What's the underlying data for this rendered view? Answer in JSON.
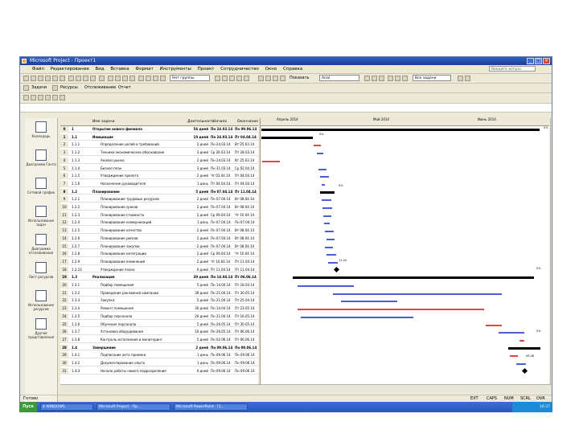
{
  "window": {
    "title": "Microsoft Project - Проект1"
  },
  "menu": {
    "items": [
      "Файл",
      "Редактирование",
      "Вид",
      "Вставка",
      "Формат",
      "Инструменты",
      "Проект",
      "Сотрудничество",
      "Окно",
      "Справка"
    ],
    "help_placeholder": "Введите вопрос"
  },
  "toolbar": {
    "group_select": "Нет группы",
    "show_label": "Показать",
    "font": "Arial",
    "filter_select": "Все задачи"
  },
  "guide_toolbar": {
    "items": [
      "Задачи",
      "Ресурсы",
      "Отслеживание",
      "Отчет"
    ]
  },
  "view_bar": {
    "items": [
      "Календарь",
      "Диаграмма Ганта",
      "Сетевой график",
      "Использование задач",
      "Диаграмма отслеживания",
      "Лист ресурсов",
      "Использование ресурсов",
      "Другие представления"
    ]
  },
  "table": {
    "headers": [
      "",
      "Имя задачи",
      "Длительность",
      "Начало",
      "Окончание"
    ],
    "rows": [
      {
        "n": "0",
        "wbs": "1",
        "name": "Открытие нового филиала",
        "dur": "56 дней",
        "start": "Пн 24.03.14",
        "finish": "Пн 09.06.14",
        "bold": true
      },
      {
        "n": "1",
        "wbs": "1.1",
        "name": "Инициация",
        "dur": "10 дней",
        "start": "Пн 24.03.14",
        "finish": "Пт 04.04.14",
        "bold": true
      },
      {
        "n": "2",
        "wbs": "1.1.1",
        "name": "Определение целей и требований",
        "dur": "2 дней",
        "start": "Пн 24.03.14",
        "finish": "Вт 25.03.14"
      },
      {
        "n": "3",
        "wbs": "1.1.2",
        "name": "Технико-экономическое обоснование",
        "dur": "3 дней",
        "start": "Ср 26.03.14",
        "finish": "Пт 28.03.14"
      },
      {
        "n": "4",
        "wbs": "1.1.3",
        "name": "Анализ рынка",
        "dur": "2 дней",
        "start": "Пн 24.03.14",
        "finish": "Вт 25.03.14"
      },
      {
        "n": "5",
        "wbs": "1.1.4",
        "name": "Бизнес-план",
        "dur": "3 дней",
        "start": "Пн 31.03.14",
        "finish": "Ср 02.04.14"
      },
      {
        "n": "6",
        "wbs": "1.1.5",
        "name": "Утверждение проекта",
        "dur": "2 дней",
        "start": "Чт 03.04.14",
        "finish": "Пт 04.04.14"
      },
      {
        "n": "7",
        "wbs": "1.1.6",
        "name": "Назначение руководителя",
        "dur": "1 день",
        "start": "Пт 04.04.14",
        "finish": "Пт 04.04.14"
      },
      {
        "n": "8",
        "wbs": "1.2",
        "name": "Планирование",
        "dur": "5 дней",
        "start": "Пн 07.04.14",
        "finish": "Пт 11.04.14",
        "bold": true
      },
      {
        "n": "9",
        "wbs": "1.2.1",
        "name": "Планирование трудовых ресурсов",
        "dur": "2 дней",
        "start": "Пн 07.04.14",
        "finish": "Вт 08.04.14"
      },
      {
        "n": "10",
        "wbs": "1.2.2",
        "name": "Планирование сроков",
        "dur": "2 дней",
        "start": "Пн 07.04.14",
        "finish": "Вт 08.04.14"
      },
      {
        "n": "11",
        "wbs": "1.2.3",
        "name": "Планирование стоимости",
        "dur": "2 дней",
        "start": "Ср 09.04.14",
        "finish": "Чт 10.04.14"
      },
      {
        "n": "12",
        "wbs": "1.2.4",
        "name": "Планирование коммуникаций",
        "dur": "1 день",
        "start": "Пн 07.04.14",
        "finish": "Пн 07.04.14"
      },
      {
        "n": "13",
        "wbs": "1.2.5",
        "name": "Планирование качества",
        "dur": "2 дней",
        "start": "Пн 07.04.14",
        "finish": "Вт 08.04.14"
      },
      {
        "n": "14",
        "wbs": "1.2.6",
        "name": "Планирование рисков",
        "dur": "2 дней",
        "start": "Пн 07.04.14",
        "finish": "Вт 08.04.14"
      },
      {
        "n": "15",
        "wbs": "1.2.7",
        "name": "Планирование закупок",
        "dur": "2 дней",
        "start": "Пн 07.04.14",
        "finish": "Вт 08.04.14"
      },
      {
        "n": "16",
        "wbs": "1.2.8",
        "name": "Планирование интеграции",
        "dur": "2 дней",
        "start": "Ср 09.04.14",
        "finish": "Чт 10.04.14"
      },
      {
        "n": "17",
        "wbs": "1.2.9",
        "name": "Планирование изменений",
        "dur": "2 дней",
        "start": "Чт 10.04.14",
        "finish": "Пт 11.04.14"
      },
      {
        "n": "18",
        "wbs": "1.2.10",
        "name": "Утверждение плана",
        "dur": "0 дней",
        "start": "Пт 11.04.14",
        "finish": "Пт 11.04.14"
      },
      {
        "n": "19",
        "wbs": "1.3",
        "name": "Реализация",
        "dur": "39 дней",
        "start": "Пн 14.04.14",
        "finish": "Пт 06.06.14",
        "bold": true
      },
      {
        "n": "20",
        "wbs": "1.3.1",
        "name": "Подбор помещения",
        "dur": "5 дней",
        "start": "Пн 14.04.14",
        "finish": "Пт 18.04.14"
      },
      {
        "n": "21",
        "wbs": "1.3.2",
        "name": "Проведение рекламной кампании",
        "dur": "30 дней",
        "start": "Пн 21.04.14",
        "finish": "Пт 30.05.14"
      },
      {
        "n": "22",
        "wbs": "1.3.3",
        "name": "Закупка",
        "dur": "5 дней",
        "start": "Пн 21.04.14",
        "finish": "Пт 25.04.14"
      },
      {
        "n": "23",
        "wbs": "1.3.4",
        "name": "Ремонт помещения",
        "dur": "30 дней",
        "start": "Пн 14.04.14",
        "finish": "Пт 23.05.14"
      },
      {
        "n": "24",
        "wbs": "1.3.5",
        "name": "Подбор персонала",
        "dur": "20 дней",
        "start": "Пн 21.04.14",
        "finish": "Пт 16.05.14"
      },
      {
        "n": "25",
        "wbs": "1.3.6",
        "name": "Обучение персонала",
        "dur": "5 дней",
        "start": "Пн 26.05.14",
        "finish": "Пт 30.05.14"
      },
      {
        "n": "26",
        "wbs": "1.3.7",
        "name": "Установка оборудования",
        "dur": "10 дней",
        "start": "Пн 26.05.14",
        "finish": "Пт 06.06.14"
      },
      {
        "n": "27",
        "wbs": "1.3.8",
        "name": "Контроль исполнения и мониторинг",
        "dur": "5 дней",
        "start": "Пн 02.06.14",
        "finish": "Пт 06.06.14"
      },
      {
        "n": "28",
        "wbs": "1.4",
        "name": "Завершение",
        "dur": "2 дней",
        "start": "Пн 09.06.14",
        "finish": "Пн 09.06.14",
        "bold": true
      },
      {
        "n": "29",
        "wbs": "1.4.1",
        "name": "Подписание акта приемки",
        "dur": "1 день",
        "start": "Пн 09.06.14",
        "finish": "Пн 09.06.14"
      },
      {
        "n": "30",
        "wbs": "1.4.2",
        "name": "Документирование опыта",
        "dur": "1 день",
        "start": "Пн 09.06.14",
        "finish": "Пн 09.06.14"
      },
      {
        "n": "31",
        "wbs": "1.4.3",
        "name": "Начало работы нового подразделения",
        "dur": "0 дней",
        "start": "Пн 09.06.14",
        "finish": "Пн 09.06.14"
      }
    ]
  },
  "gantt": {
    "months": [
      "Апрель 2014",
      "Май 2014",
      "Июнь 2014"
    ],
    "labels": [
      "0%",
      "0%",
      "0%",
      "0%",
      "11.04",
      "0%",
      "09.06"
    ]
  },
  "status": {
    "text": "Готово",
    "indicators": [
      "EXT",
      "CAPS",
      "NUM",
      "SCRL",
      "OVR"
    ]
  },
  "taskbar": {
    "start": "Пуск",
    "tasks": [
      "4 WINDOWS",
      "Microsoft Project - Пр...",
      "Microsoft PowerPoint - [1..."
    ],
    "clock": "16:37"
  },
  "colors": {
    "accent": "#2f5fbf",
    "critical": "#e04848",
    "normal": "#4a5fd8"
  }
}
